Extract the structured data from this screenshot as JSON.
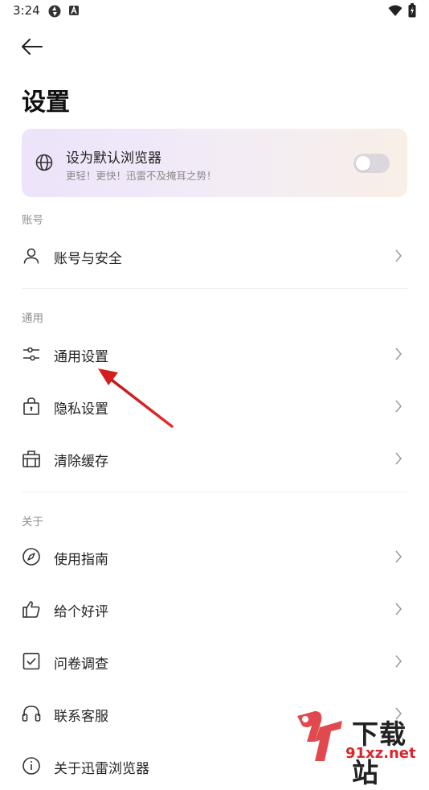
{
  "status_bar": {
    "time": "3:24"
  },
  "page": {
    "title": "设置"
  },
  "banner": {
    "title": "设为默认浏览器",
    "subtitle": "更轻！更快！迅雷不及掩耳之势！",
    "toggle_on": false
  },
  "sections": {
    "account": {
      "label": "账号",
      "items": [
        {
          "label": "账号与安全",
          "icon": "person-icon"
        }
      ]
    },
    "general": {
      "label": "通用",
      "items": [
        {
          "label": "通用设置",
          "icon": "sliders-icon"
        },
        {
          "label": "隐私设置",
          "icon": "lock-bag-icon"
        },
        {
          "label": "清除缓存",
          "icon": "broom-icon"
        }
      ]
    },
    "about": {
      "label": "关于",
      "items": [
        {
          "label": "使用指南",
          "icon": "compass-icon"
        },
        {
          "label": "给个好评",
          "icon": "thumbs-up-icon"
        },
        {
          "label": "问卷调查",
          "icon": "checkbox-icon"
        },
        {
          "label": "联系客服",
          "icon": "headset-icon"
        },
        {
          "label": "关于迅雷浏览器",
          "icon": "info-icon"
        }
      ]
    }
  },
  "watermark": {
    "title": "下载站",
    "url": "91xz.net",
    "logo": "9f"
  }
}
